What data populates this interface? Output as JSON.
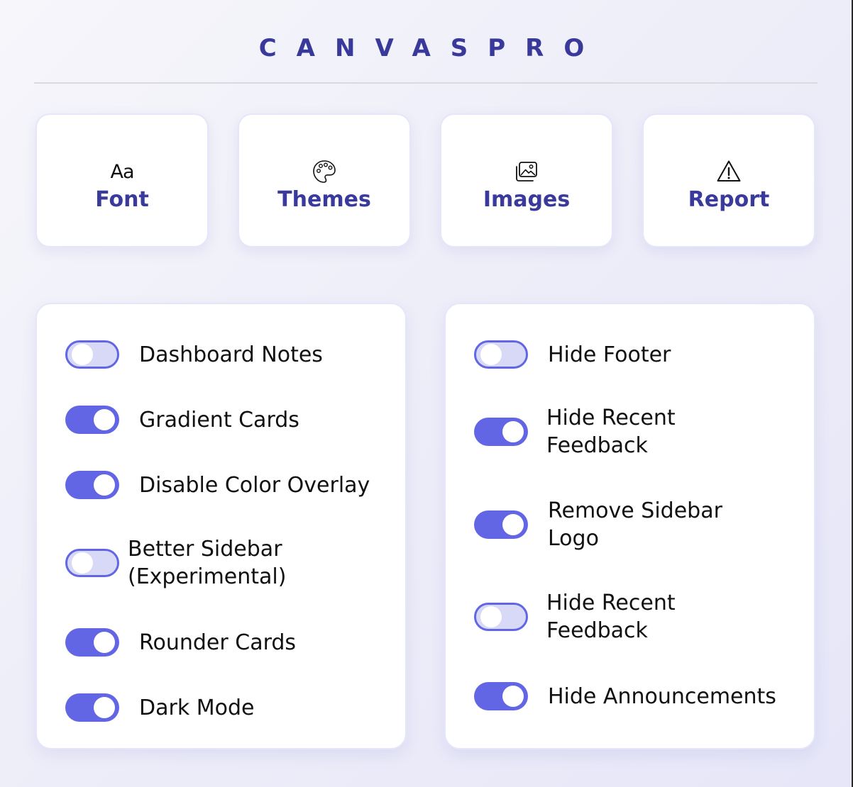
{
  "app": {
    "title": "CANVASPRO"
  },
  "tiles": [
    {
      "label": "Font",
      "icon": "font-icon",
      "glyph": "Aa"
    },
    {
      "label": "Themes",
      "icon": "palette-icon"
    },
    {
      "label": "Images",
      "icon": "images-icon"
    },
    {
      "label": "Report",
      "icon": "warning-icon"
    }
  ],
  "left_options": [
    {
      "label": "Dashboard Notes",
      "enabled": false
    },
    {
      "label": "Gradient Cards",
      "enabled": true
    },
    {
      "label": "Disable Color Overlay",
      "enabled": true
    },
    {
      "label": "Better Sidebar (Experimental)",
      "enabled": false
    },
    {
      "label": "Rounder Cards",
      "enabled": true
    },
    {
      "label": "Dark Mode",
      "enabled": true
    }
  ],
  "right_options": [
    {
      "label": "Hide Footer",
      "enabled": false
    },
    {
      "label": "Hide Recent Feedback",
      "enabled": true
    },
    {
      "label": "Remove Sidebar Logo",
      "enabled": true
    },
    {
      "label": "Hide Recent Feedback",
      "enabled": false
    },
    {
      "label": "Hide Announcements",
      "enabled": true
    }
  ],
  "colors": {
    "accent": "#6366e4",
    "title": "#39399b",
    "toggle_off_fill": "#d8d9f6"
  }
}
